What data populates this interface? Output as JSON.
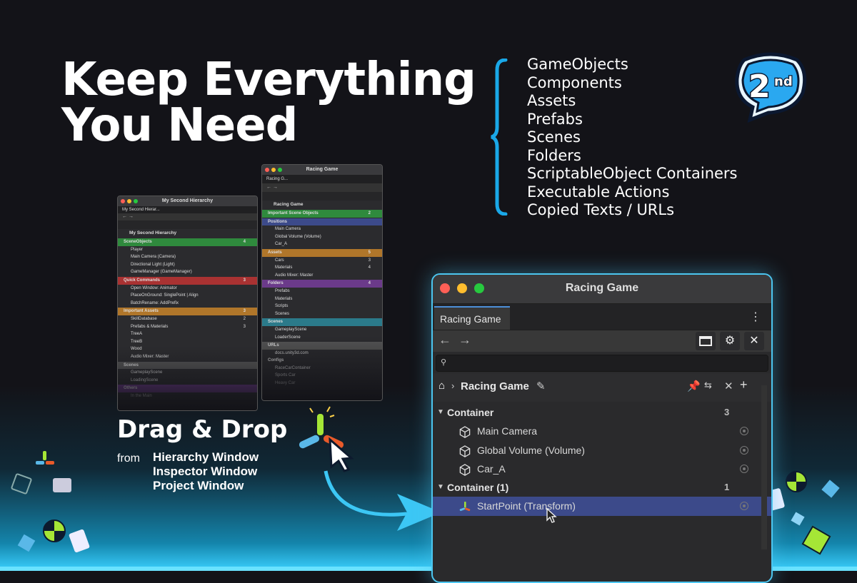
{
  "headline": {
    "line1": "Keep Everything",
    "line2": "You Need"
  },
  "features": [
    "GameObjects",
    "Components",
    "Assets",
    "Prefabs",
    "Scenes",
    "Folders",
    "ScriptableObject Containers",
    "Executable Actions",
    "Copied Texts / URLs"
  ],
  "badge": {
    "number": "2",
    "suffix": "nd"
  },
  "drag_drop": {
    "title": "Drag & Drop",
    "from": "from",
    "sources": [
      "Hierarchy Window",
      "Inspector Window",
      "Project Window"
    ]
  },
  "mini_window_left": {
    "title": "My Second Hierarchy",
    "tab": "My Second Hierar...",
    "path": "My Second Hierarchy",
    "rows": [
      {
        "label": "SceneObjects",
        "count": "4",
        "color": "#2f8a3d",
        "header": true
      },
      {
        "label": "Player"
      },
      {
        "label": "Main Camera (Camera)"
      },
      {
        "label": "Directional Light (Light)"
      },
      {
        "label": "GameManager (GameManager)"
      },
      {
        "label": "Quick Commands",
        "count": "3",
        "color": "#a93232",
        "header": true
      },
      {
        "label": "Open Window: Animator"
      },
      {
        "label": "PlaceOnGround: SinglePoint | Align"
      },
      {
        "label": "BatchRename: AddPrefix"
      },
      {
        "label": "Important Assets",
        "count": "3",
        "color": "#b0762a",
        "header": true
      },
      {
        "label": "SkillDatabase",
        "count": "2"
      },
      {
        "label": "Prefabs & Materials",
        "count": "3"
      },
      {
        "label": "TreeA"
      },
      {
        "label": "TreeB"
      },
      {
        "label": "Wood"
      },
      {
        "label": "Audio Mixer: Master"
      },
      {
        "label": "Scenes",
        "color": "#555",
        "header": true
      },
      {
        "label": "GameplayScene"
      },
      {
        "label": "LoadingScene"
      },
      {
        "label": "Others",
        "color": "#6b3a8a",
        "header": true
      },
      {
        "label": "In the Main"
      }
    ]
  },
  "mini_window_right": {
    "title": "Racing Game",
    "tab": "Racing G...",
    "path": "Racing Game",
    "rows": [
      {
        "label": "Important Scene Objects",
        "count": "2",
        "color": "#2f8a3d",
        "header": true
      },
      {
        "label": "Positions",
        "color": "#3c4a8a",
        "header": true
      },
      {
        "label": "Main Camera"
      },
      {
        "label": "Global Volume (Volume)"
      },
      {
        "label": "Car_A"
      },
      {
        "label": "Assets",
        "count": "5",
        "color": "#b0762a",
        "header": true
      },
      {
        "label": "Cars",
        "count": "3"
      },
      {
        "label": "Materials",
        "count": "4"
      },
      {
        "label": "Audio Mixer: Master"
      },
      {
        "label": "Folders",
        "count": "4",
        "color": "#6b3a8a",
        "header": true
      },
      {
        "label": "Prefabs"
      },
      {
        "label": "Materials"
      },
      {
        "label": "Scripts"
      },
      {
        "label": "Scenes"
      },
      {
        "label": "Scenes",
        "color": "#2b7a8a",
        "header": true
      },
      {
        "label": "GameplayScene"
      },
      {
        "label": "LoaderScene"
      },
      {
        "label": "URLs",
        "color": "#555",
        "header": true
      },
      {
        "label": "docs.unity3d.com"
      },
      {
        "label": "Configs",
        "header": true
      },
      {
        "label": "RaceCarContainer"
      },
      {
        "label": "Sports Car"
      },
      {
        "label": "Heavy Car"
      }
    ]
  },
  "main_window": {
    "title": "Racing Game",
    "tab": "Racing Game",
    "path_name": "Racing Game",
    "groups": [
      {
        "label": "Container",
        "count": "3",
        "items": [
          "Main Camera",
          "Global Volume (Volume)",
          "Car_A"
        ]
      },
      {
        "label": "Container (1)",
        "count": "1",
        "items": [
          "StartPoint (Transform)"
        ]
      }
    ]
  },
  "colors": {
    "accent": "#4cc6f0",
    "selection": "#3c4a8a",
    "pin": "#4a8cf0"
  }
}
